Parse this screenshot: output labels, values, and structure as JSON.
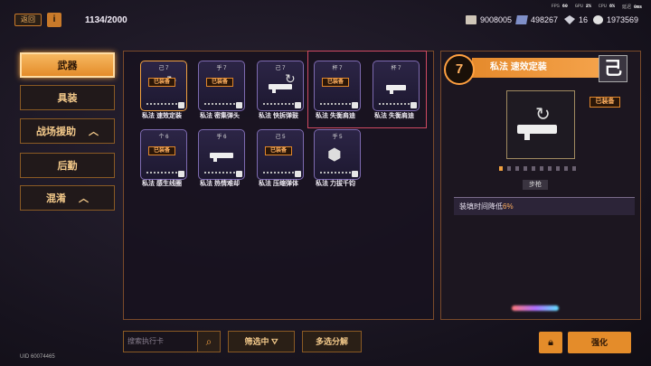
{
  "header": {
    "back_label": "返回",
    "info_label": "i",
    "capacity": "1134/2000"
  },
  "stats": {
    "fps_label": "FPS",
    "fps_value": "60",
    "gpu_label": "GPU",
    "gpu_value": "2%",
    "cpu_label": "CPU",
    "cpu_value": "8%",
    "delay_label": "延迟",
    "delay_value": "0ms"
  },
  "resources": [
    {
      "icon": "cash-icon",
      "value": "9008005"
    },
    {
      "icon": "cube-icon",
      "value": "498267"
    },
    {
      "icon": "gem-icon",
      "value": "16"
    },
    {
      "icon": "coin-icon",
      "value": "1973569"
    }
  ],
  "sidebar": [
    {
      "label": "武器",
      "active": true
    },
    {
      "label": "具装"
    },
    {
      "label": "战场援助",
      "chev": "^"
    },
    {
      "label": "后勤"
    },
    {
      "label": "混淆",
      "chev": "^"
    }
  ],
  "cards": [
    {
      "level": "己 7",
      "name": "私法 速效定装",
      "equipped": "已装备"
    },
    {
      "level": "乎 7",
      "name": "私法 密集弹头",
      "equipped": "已装备"
    },
    {
      "level": "己 7",
      "name": "私法 快拆弹鼓"
    },
    {
      "level": "杯 7",
      "name": "私法 失衡肩迪",
      "equipped": "已装备"
    },
    {
      "level": "杯 7",
      "name": "私法 失衡肩迪"
    },
    {
      "level": "个 6",
      "name": "私法 感生线圈",
      "equipped": "已装备"
    },
    {
      "level": "乎 6",
      "name": "私法 热情难却"
    },
    {
      "level": "己 5",
      "name": "私法 压缩弹体",
      "equipped": "已装备"
    },
    {
      "level": "乎 5",
      "name": "私法 力拔千钧"
    }
  ],
  "detail": {
    "level": "7",
    "title": "私法 速效定装",
    "type_glyph": "己",
    "equipped": "已装备",
    "weapon_type": "步枪",
    "effect_prefix": "装填时间降低",
    "effect_value": "6%",
    "dots_total": 10,
    "dots_on": 1
  },
  "bottom": {
    "search_placeholder": "搜索执行卡",
    "filter_label": "筛选中",
    "multi_label": "多选分解",
    "lock_icon": "lock-icon",
    "enhance_label": "强化"
  },
  "uid": "UID 60074465",
  "colors": {
    "accent": "#e48c2a",
    "frame": "#7d6ab0",
    "selected": "#d04a62"
  }
}
